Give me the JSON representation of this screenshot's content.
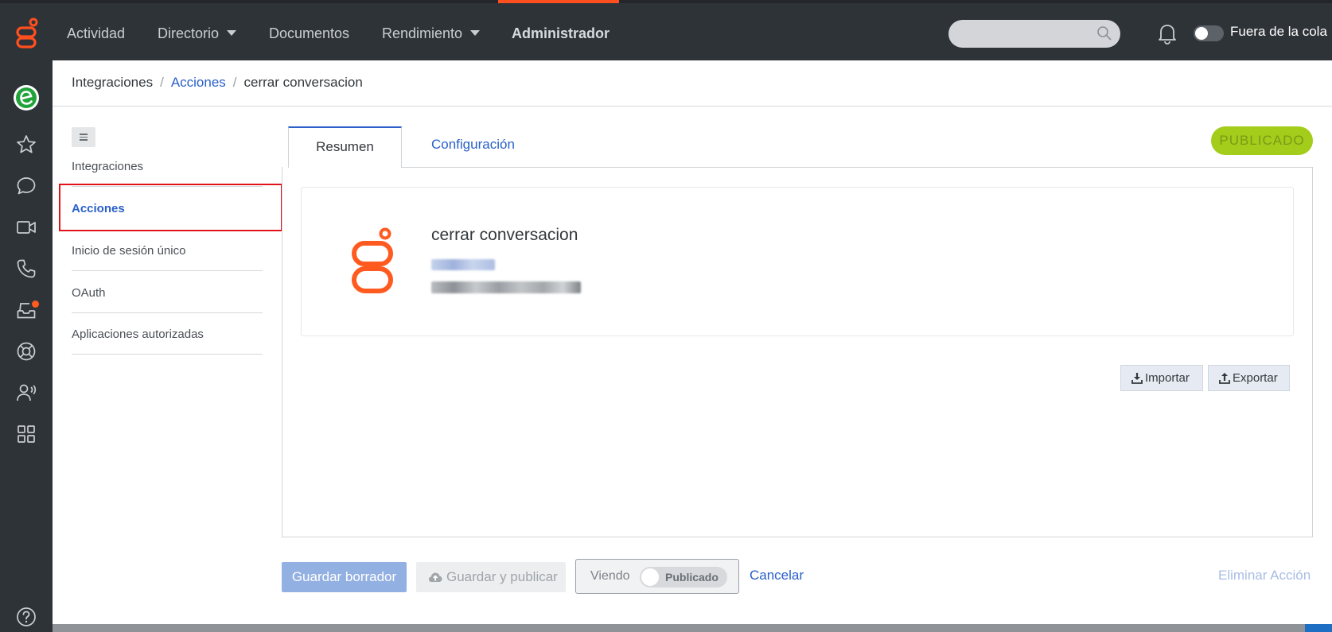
{
  "colors": {
    "topbar": "#2e3338",
    "accent_orange": "#ff4f1f",
    "link_blue": "#2a60c8",
    "published_green": "#a3cc1b",
    "highlight_red": "#e0121a"
  },
  "topnav": {
    "items": [
      {
        "label": "Actividad",
        "has_dropdown": false
      },
      {
        "label": "Directorio",
        "has_dropdown": true
      },
      {
        "label": "Documentos",
        "has_dropdown": false
      },
      {
        "label": "Rendimiento",
        "has_dropdown": true
      },
      {
        "label": "Administrador",
        "has_dropdown": false,
        "active": true
      }
    ],
    "search_placeholder": "",
    "queue_toggle_label": "Fuera de la cola"
  },
  "rail": {
    "icons": [
      "app-logo-icon",
      "favorites-star-icon",
      "chat-icon",
      "video-icon",
      "phone-icon",
      "inbox-icon",
      "help-lifebuoy-icon",
      "contacts-icon",
      "apps-grid-icon",
      "help-question-icon"
    ]
  },
  "breadcrumb": {
    "root": "Integraciones",
    "link": "Acciones",
    "current": "cerrar conversacion",
    "separator": "/"
  },
  "sidebar": {
    "items": [
      {
        "label": "Integraciones",
        "active": false
      },
      {
        "label": "Acciones",
        "active": true
      },
      {
        "label": "Inicio de sesión único",
        "active": false
      },
      {
        "label": "OAuth",
        "active": false
      },
      {
        "label": "Aplicaciones autorizadas",
        "active": false
      }
    ]
  },
  "tabs": {
    "summary": "Resumen",
    "configuration": "Configuración",
    "active": "Resumen"
  },
  "status_badge": "PUBLICADO",
  "card": {
    "title": "cerrar conversacion"
  },
  "actions": {
    "import": "Importar",
    "export": "Exportar"
  },
  "footer": {
    "save_draft": "Guardar borrador",
    "save_publish": "Guardar y publicar",
    "viewing_label": "Viendo",
    "viewing_state": "Publicado",
    "cancel": "Cancelar",
    "delete": "Eliminar Acción"
  }
}
